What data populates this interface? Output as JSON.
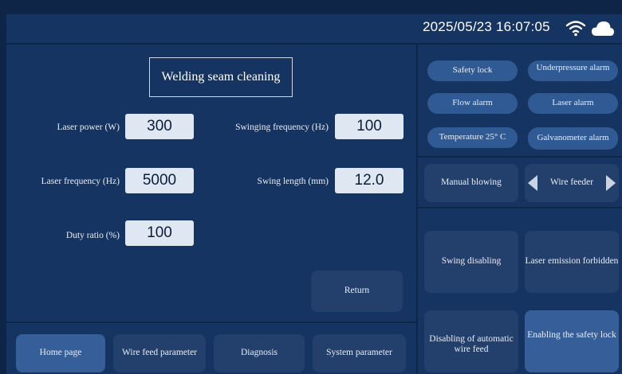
{
  "status_bar": {
    "datetime": "2025/05/23 16:07:05",
    "wifi_icon": "wifi-icon",
    "cloud_icon": "cloud-icon"
  },
  "main": {
    "title": "Welding seam cleaning",
    "fields": {
      "laser_power": {
        "label": "Laser power (W)",
        "value": "300"
      },
      "laser_frequency": {
        "label": "Laser frequency (Hz)",
        "value": "5000"
      },
      "duty_ratio": {
        "label": "Duty ratio (%)",
        "value": "100"
      },
      "swinging_frequency": {
        "label": "Swinging frequency (Hz)",
        "value": "100"
      },
      "swing_length": {
        "label": "Swing length (mm)",
        "value": "12.0"
      }
    },
    "return_label": "Return"
  },
  "nav": {
    "home": "Home page",
    "wire_feed": "Wire feed parameter",
    "diagnosis": "Diagnosis",
    "system": "System parameter"
  },
  "status": {
    "safety_lock": "Safety lock",
    "underpressure_alarm": "Underpressure alarm",
    "flow_alarm": "Flow alarm",
    "laser_alarm": "Laser alarm",
    "temperature": "Temperature 25° C",
    "galvanometer_alarm": "Galvanometer alarm"
  },
  "controls": {
    "manual_blowing": "Manual blowing",
    "wire_feeder": "Wire feeder",
    "swing_disabling": "Swing disabling",
    "laser_emission_forbidden": "Laser emission forbidden",
    "disabling_auto_wire_feed": "Disabling of automatic wire feed",
    "enabling_safety_lock": "Enabling the safety lock"
  },
  "colors": {
    "background": "#0f2547",
    "panel": "#163461",
    "button": "#233f6b",
    "active": "#365f99",
    "pill": "#305a94",
    "value_box": "#dfe8f2"
  }
}
